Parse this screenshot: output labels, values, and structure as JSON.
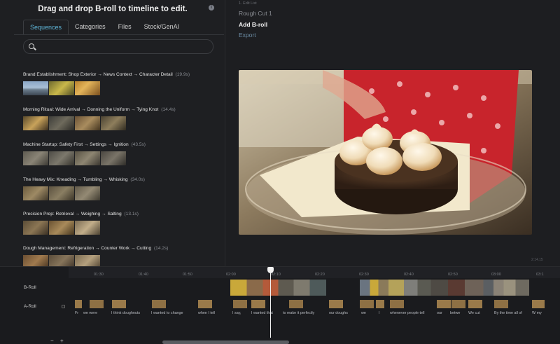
{
  "left_panel": {
    "title": "Drag and drop B-roll to timeline to edit.",
    "tabs": [
      "Sequences",
      "Categories",
      "Files",
      "Stock/GenAI"
    ],
    "active_tab": "Sequences",
    "search": {
      "value": "",
      "placeholder": ""
    },
    "sequences": [
      {
        "title": "Brand Establishment: Shop Exterior → News Context → Character Detail",
        "duration": "(19.9s)"
      },
      {
        "title": "Morning Ritual: Wide Arrival → Donning the Uniform → Tying Knot",
        "duration": "(14.4s)"
      },
      {
        "title": "Machine Startup: Safety First → Settings → Ignition",
        "duration": "(43.5s)"
      },
      {
        "title": "The Heavy Mix: Kneading → Tumbling → Whisking",
        "duration": "(34.0s)"
      },
      {
        "title": "Precision Prep: Retrieval → Weighing → Salting",
        "duration": "(13.1s)"
      },
      {
        "title": "Dough Management: Refrigeration → Counter Work → Cutting",
        "duration": "(14.2s)"
      }
    ]
  },
  "right_panel": {
    "breadcrumb": "1. Edit List",
    "menu": [
      "Rough Cut 1",
      "Add B-roll",
      "Export"
    ],
    "time_badge": "2:14.15"
  },
  "timeline": {
    "ticks": [
      "01:30",
      "01:40",
      "01:50",
      "02:00",
      "02:10",
      "02:20",
      "02:30",
      "02:40",
      "02:50",
      "03:00",
      "03:1"
    ],
    "tracks": [
      "B-Roll",
      "A-Roll"
    ],
    "captions": [
      "Fr",
      "we were",
      "I think doughnuts",
      "I wanted to change",
      "when I tell",
      "I say,",
      "I wanted that",
      "to make it perfectly",
      "our doughs",
      "we",
      "I",
      "whenever people tell",
      "our",
      "betwe",
      "We cut",
      "By the time all of",
      "W my"
    ],
    "zoom_out": "−",
    "zoom_in": "+"
  },
  "colors": {
    "accent": "#5fb6d9",
    "background": "#1e1f22",
    "playhead": "#f2f2f2"
  }
}
